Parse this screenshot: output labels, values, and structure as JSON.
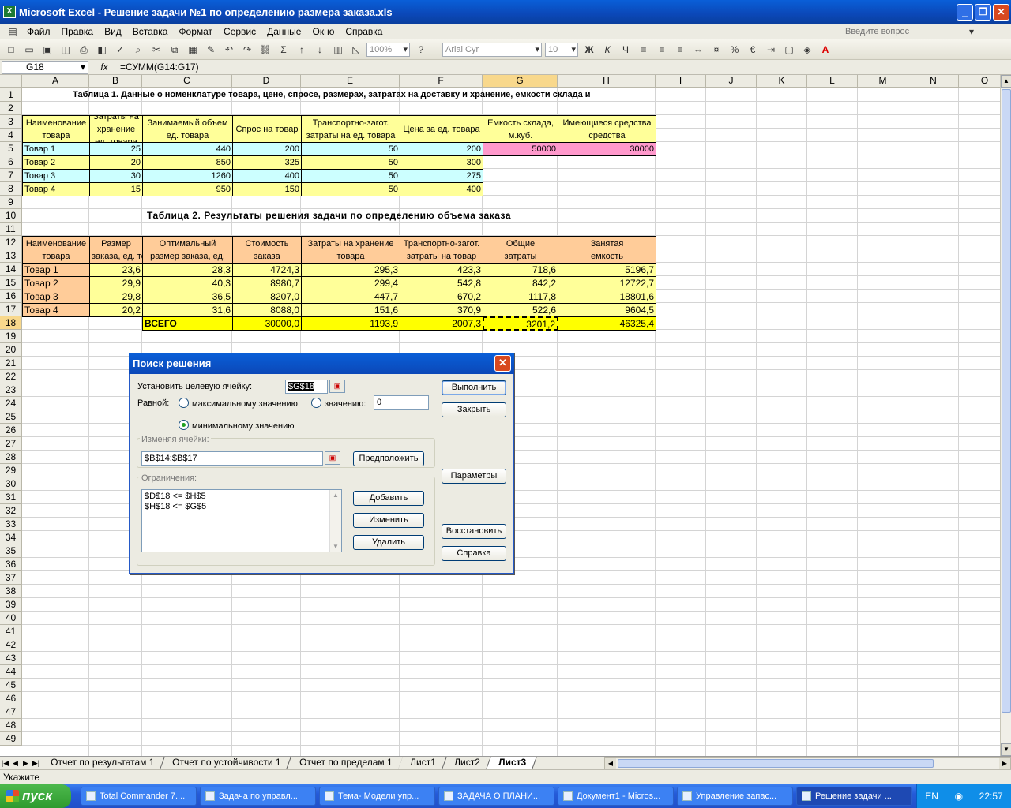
{
  "window": {
    "title": "Microsoft Excel - Решение задачи №1 по определению размера заказа.xls",
    "min": "_",
    "restore": "❐",
    "close": "✕"
  },
  "menu": {
    "items": [
      "Файл",
      "Правка",
      "Вид",
      "Вставка",
      "Формат",
      "Сервис",
      "Данные",
      "Окно",
      "Справка"
    ],
    "ask_placeholder": "Введите вопрос"
  },
  "toolbar": {
    "zoom": "100%",
    "font": "Arial Cyr",
    "size": "10",
    "bold": "Ж",
    "italic": "К",
    "underline": "Ч",
    "percent": "%",
    "euro": "€",
    "sigma": "Σ"
  },
  "formula_bar": {
    "cell_ref": "G18",
    "fx": "fx",
    "formula": "=СУММ(G14:G17)"
  },
  "columns": [
    "A",
    "B",
    "C",
    "D",
    "E",
    "F",
    "G",
    "H",
    "I",
    "J",
    "K",
    "L",
    "M",
    "N",
    "O"
  ],
  "selected_column": "G",
  "rows": [
    "1",
    "2",
    "3",
    "4",
    "5",
    "6",
    "7",
    "8",
    "9",
    "10",
    "11",
    "12",
    "13",
    "14",
    "15",
    "16",
    "17",
    "18",
    "19",
    "20",
    "21",
    "22",
    "23",
    "24",
    "25",
    "26",
    "27",
    "28",
    "29",
    "30",
    "31",
    "32",
    "33",
    "34",
    "35",
    "36",
    "37",
    "38",
    "39",
    "40",
    "41",
    "42",
    "43",
    "44",
    "45",
    "46",
    "47",
    "48",
    "49"
  ],
  "selected_row": "18",
  "table1": {
    "title": "Таблица 1. Данные о номенклатуре товара, цене, спросе, размерах, затратах на доставку и хранение, емкости склада и",
    "headers": [
      [
        "Наименование",
        "товара"
      ],
      [
        "Затраты на",
        "хранение",
        "ед. товара"
      ],
      [
        "Занимаемый объем",
        "ед. товара"
      ],
      [
        "Спрос на товар"
      ],
      [
        "Транспортно-загот.",
        "затраты на ед. товара"
      ],
      [
        "Цена за ед. товара"
      ],
      [
        "Емкость склада,",
        "м.куб."
      ],
      [
        "Имеющиеся средства",
        "средства"
      ]
    ],
    "rows": [
      [
        "Товар 1",
        "25",
        "440",
        "200",
        "50",
        "200",
        "50000",
        "30000"
      ],
      [
        "Товар 2",
        "20",
        "850",
        "325",
        "50",
        "300"
      ],
      [
        "Товар 3",
        "30",
        "1260",
        "400",
        "50",
        "275"
      ],
      [
        "Товар 4",
        "15",
        "950",
        "150",
        "50",
        "400"
      ]
    ]
  },
  "table2": {
    "title": "Таблица 2. Результаты решения задачи по определению объема заказа",
    "headers": [
      [
        "Наименование",
        "товара"
      ],
      [
        "Размер",
        "заказа, ед. товара"
      ],
      [
        "Оптимальный",
        "размер заказа, ед."
      ],
      [
        "Стоимость",
        "заказа"
      ],
      [
        "Затраты на хранение",
        "товара"
      ],
      [
        "Транспортно-загот.",
        "затраты на товар"
      ],
      [
        "Общие",
        "затраты"
      ],
      [
        "Занятая",
        "емкость"
      ]
    ],
    "rows": [
      [
        "Товар 1",
        "23,6",
        "28,3",
        "4724,3",
        "295,3",
        "423,3",
        "718,6",
        "5196,7"
      ],
      [
        "Товар 2",
        "29,9",
        "40,3",
        "8980,7",
        "299,4",
        "542,8",
        "842,2",
        "12722,7"
      ],
      [
        "Товар 3",
        "29,8",
        "36,5",
        "8207,0",
        "447,7",
        "670,2",
        "1117,8",
        "18801,6"
      ],
      [
        "Товар 4",
        "20,2",
        "31,6",
        "8088,0",
        "151,6",
        "370,9",
        "522,6",
        "9604,5"
      ]
    ],
    "total": [
      "ВСЕГО",
      "30000,0",
      "1193,9",
      "2007,3",
      "3201,2",
      "46325,4"
    ]
  },
  "dialog": {
    "title": "Поиск решения",
    "target_label": "Установить целевую ячейку:",
    "target_value": "$G$18",
    "equal_label": "Равной:",
    "opt_max": "максимальному значению",
    "opt_value": "значению:",
    "value_field": "0",
    "opt_min": "минимальному значению",
    "selected_option": "min",
    "changing_label": "Изменяя ячейки:",
    "changing_value": "$B$14:$B$17",
    "guess": "Предположить",
    "constraints_label": "Ограничения:",
    "constraints": [
      "$D$18 <= $H$5",
      "$H$18 <= $G$5"
    ],
    "add": "Добавить",
    "change": "Изменить",
    "delete": "Удалить",
    "solve": "Выполнить",
    "close": "Закрыть",
    "options": "Параметры",
    "reset": "Восстановить",
    "help": "Справка"
  },
  "sheet_tabs": [
    "Отчет по результатам 1",
    "Отчет по устойчивости 1",
    "Отчет по пределам 1",
    "Лист1",
    "Лист2",
    "Лист3"
  ],
  "active_tab": "Лист3",
  "status": "Укажите",
  "taskbar": {
    "start": "пуск",
    "tasks": [
      "Total Commander 7....",
      "Задача по управл...",
      "Тема- Модели упр...",
      "ЗАДАЧА О ПЛАНИ...",
      "Документ1 - Micros...",
      "Управление запас...",
      "Решение задачи ..."
    ],
    "lang": "EN",
    "clock": "22:57"
  },
  "colors": {
    "cyan": "#ccffff",
    "yellow": "#ffff99",
    "pink": "#ff99cc",
    "orange": "#ffcc99",
    "bright_yellow": "#ffff00",
    "header_sel": "#f8d88c"
  }
}
